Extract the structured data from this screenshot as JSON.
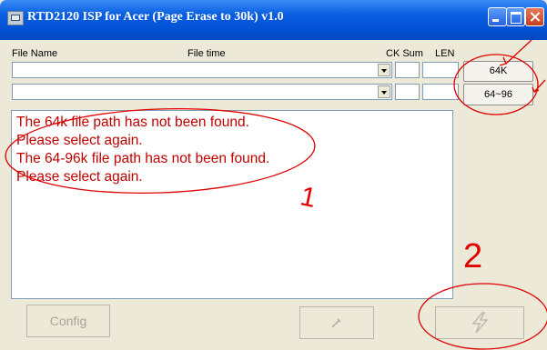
{
  "window": {
    "title": "RTD2120 ISP for Acer (Page Erase to 30k) v1.0"
  },
  "headers": {
    "file_name": "File Name",
    "file_time": "File time",
    "ck_sum": "CK Sum",
    "len": "LEN"
  },
  "buttons": {
    "load_64k": "64K",
    "load_64_96": "64~96",
    "config": "Config",
    "middle_icon": "wrench-icon",
    "right_icon": "lightning-icon"
  },
  "log": [
    "The 64k file path has not  been found.",
    "Please select again.",
    "The 64-96k file path has not been found.",
    "Please select again."
  ],
  "annotations": {
    "mark_1": "1",
    "mark_2": "2",
    "color": "#e00000"
  },
  "colors": {
    "title_bar": "#0a5fe0",
    "window_bg": "#ece9d8",
    "log_text": "#c00000"
  }
}
